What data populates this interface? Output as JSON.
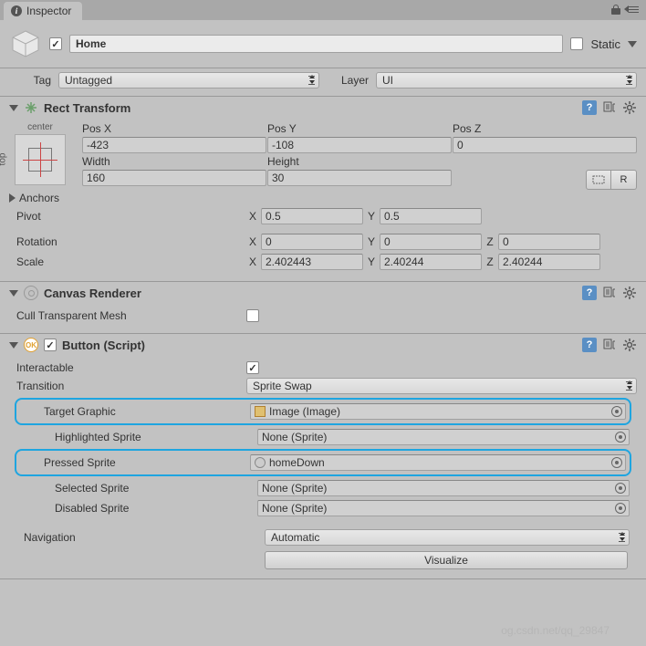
{
  "tab": {
    "title": "Inspector"
  },
  "header": {
    "name": "Home",
    "static": "Static"
  },
  "tagLayer": {
    "tagLabel": "Tag",
    "tag": "Untagged",
    "layerLabel": "Layer",
    "layer": "UI"
  },
  "rect": {
    "title": "Rect Transform",
    "anchorH": "center",
    "anchorV": "top",
    "posXLabel": "Pos X",
    "posX": "-423",
    "posYLabel": "Pos Y",
    "posY": "-108",
    "posZLabel": "Pos Z",
    "posZ": "0",
    "widthLabel": "Width",
    "width": "160",
    "heightLabel": "Height",
    "height": "30",
    "btnR": "R",
    "anchorsLabel": "Anchors",
    "pivotLabel": "Pivot",
    "pivotX": "0.5",
    "pivotY": "0.5",
    "rotationLabel": "Rotation",
    "rotX": "0",
    "rotY": "0",
    "rotZ": "0",
    "scaleLabel": "Scale",
    "scaleX": "2.402443",
    "scaleY": "2.40244",
    "scaleZ": "2.40244",
    "X": "X",
    "Y": "Y",
    "Z": "Z"
  },
  "canvas": {
    "title": "Canvas Renderer",
    "cullLabel": "Cull Transparent Mesh"
  },
  "button": {
    "title": "Button (Script)",
    "interactableLabel": "Interactable",
    "transitionLabel": "Transition",
    "transition": "Sprite Swap",
    "targetGraphicLabel": "Target Graphic",
    "targetGraphic": "Image (Image)",
    "highlightedLabel": "Highlighted Sprite",
    "highlighted": "None (Sprite)",
    "pressedLabel": "Pressed Sprite",
    "pressed": "homeDown",
    "selectedLabel": "Selected Sprite",
    "selected": "None (Sprite)",
    "disabledLabel": "Disabled Sprite",
    "disabled": "None (Sprite)",
    "navigationLabel": "Navigation",
    "navigation": "Automatic",
    "visualize": "Visualize"
  },
  "watermark": "og.csdn.net/qq_29847"
}
